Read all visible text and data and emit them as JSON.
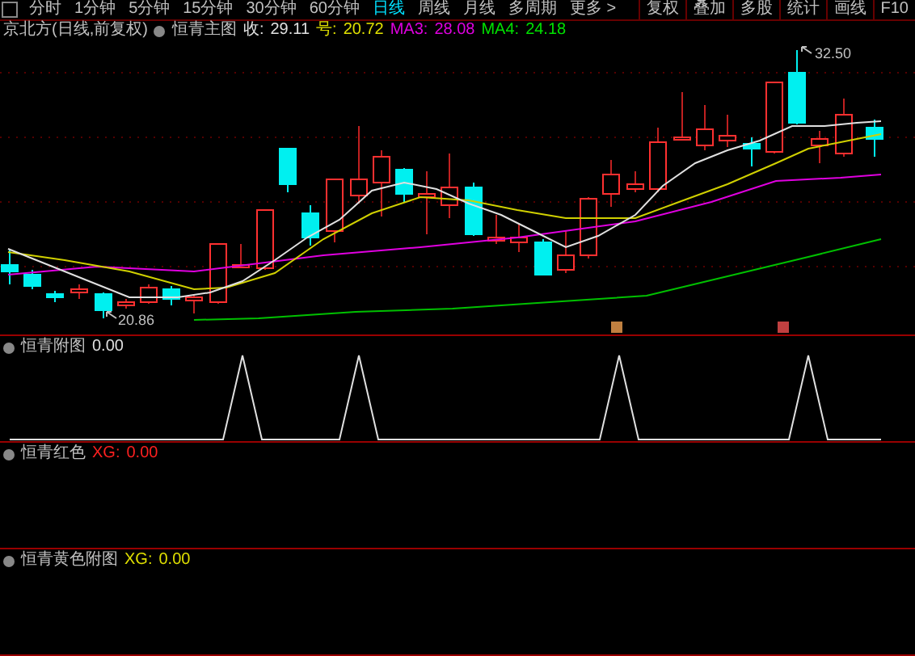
{
  "toolbar": {
    "periods": [
      {
        "label": "分时",
        "selected": false
      },
      {
        "label": "1分钟",
        "selected": false
      },
      {
        "label": "5分钟",
        "selected": false
      },
      {
        "label": "15分钟",
        "selected": false
      },
      {
        "label": "30分钟",
        "selected": false
      },
      {
        "label": "60分钟",
        "selected": false
      },
      {
        "label": "日线",
        "selected": true
      },
      {
        "label": "周线",
        "selected": false
      },
      {
        "label": "月线",
        "selected": false
      },
      {
        "label": "多周期",
        "selected": false
      },
      {
        "label": "更多 >",
        "selected": false
      }
    ],
    "tools": [
      "复权",
      "叠加",
      "多股",
      "统计",
      "画线",
      "F10"
    ]
  },
  "info": {
    "stock_title": "京北方(日线,前复权)",
    "indicator_name": "恒青主图",
    "readings": [
      {
        "label": "收:",
        "value": "29.11",
        "color": "#e0e0e0"
      },
      {
        "label": "号:",
        "value": "20.72",
        "color": "#e0e000"
      },
      {
        "label": "MA3:",
        "value": "28.08",
        "color": "#e000e0"
      },
      {
        "label": "MA4:",
        "value": "24.18",
        "color": "#00e000"
      }
    ]
  },
  "main_chart": {
    "high_label": "32.50",
    "low_label": "20.86"
  },
  "sub_panels": [
    {
      "title": "恒青附图",
      "value": "0.00",
      "color": "#e0e0e0"
    },
    {
      "title": "恒青红色",
      "label": "XG:",
      "value": "0.00",
      "color": "#ff2020"
    },
    {
      "title": "恒青黄色附图",
      "label": "XG:",
      "value": "0.00",
      "color": "#e0e000"
    }
  ]
}
